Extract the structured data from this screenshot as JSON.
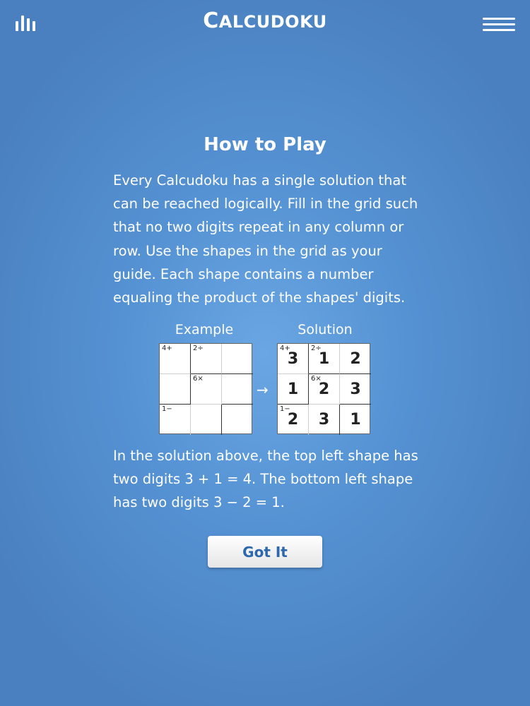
{
  "header": {
    "title_first": "C",
    "title_rest": "alcudoku"
  },
  "howto": {
    "heading": "How to Play",
    "paragraph1": "Every Calcudoku has a single solution that can be reached logically. Fill in the grid such that no two digits repeat in any column or row. Use the shapes in the grid as your guide. Each shape contains a number equaling the product of the shapes' digits.",
    "example_label": "Example",
    "solution_label": "Solution",
    "arrow": "→",
    "paragraph2": "In the solution above, the top left shape has two digits 3 + 1 = 4. The bottom left shape has two digits 3 − 2 = 1.",
    "button_label": "Got It"
  },
  "example_grid": {
    "clues": [
      "4+",
      "2÷",
      "",
      "",
      "6×",
      "",
      "1−",
      "",
      ""
    ],
    "values": [
      "",
      "",
      "",
      "",
      "",
      "",
      "",
      "",
      ""
    ]
  },
  "solution_grid": {
    "clues": [
      "4+",
      "2÷",
      "",
      "",
      "6×",
      "",
      "1−",
      "",
      ""
    ],
    "values": [
      "3",
      "1",
      "2",
      "1",
      "2",
      "3",
      "2",
      "3",
      "1"
    ]
  },
  "colors": {
    "background": "#5592d3",
    "button_text": "#2d68ad"
  },
  "icons": {
    "left": "bar-chart-icon",
    "right": "hamburger-menu-icon"
  }
}
